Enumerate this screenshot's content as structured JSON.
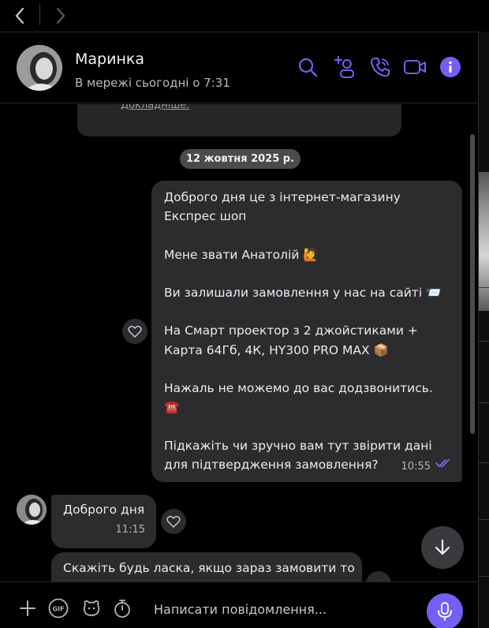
{
  "contact": {
    "name": "Маринка",
    "status": "В мережі сьогодні о 7:31"
  },
  "header_icons": [
    "search-icon",
    "add-participant-icon",
    "call-icon",
    "video-call-icon",
    "info-icon"
  ],
  "accent_color": "#7360f2",
  "messages": {
    "previous_link": "Докладніше.",
    "date_separator": "12 жовтня 2025 р.",
    "outgoing": {
      "text": "Доброго дня це з інтернет-магазину Експрес шоп\n\nМене звати Анатолій 🙋\n\nВи залишали замовлення у нас на сайті 📨\n\nНа  Смарт проектор з 2 джойстиками + Карта 64Гб, 4К, HY300 PRO MAX 📦\n\nНажаль не можемо до вас додзвонитись. ☎️\n\nПідкажіть чи зручно вам тут звірити дані для підтвердження замовлення?",
      "time": "10:55",
      "status": "read"
    },
    "incoming": [
      {
        "text": "Доброго дня",
        "time": "11:15"
      },
      {
        "text": "Скажіть будь ласка, якщо зараз замовити то",
        "time": ""
      }
    ]
  },
  "composer": {
    "placeholder": "Написати повідомлення..."
  }
}
